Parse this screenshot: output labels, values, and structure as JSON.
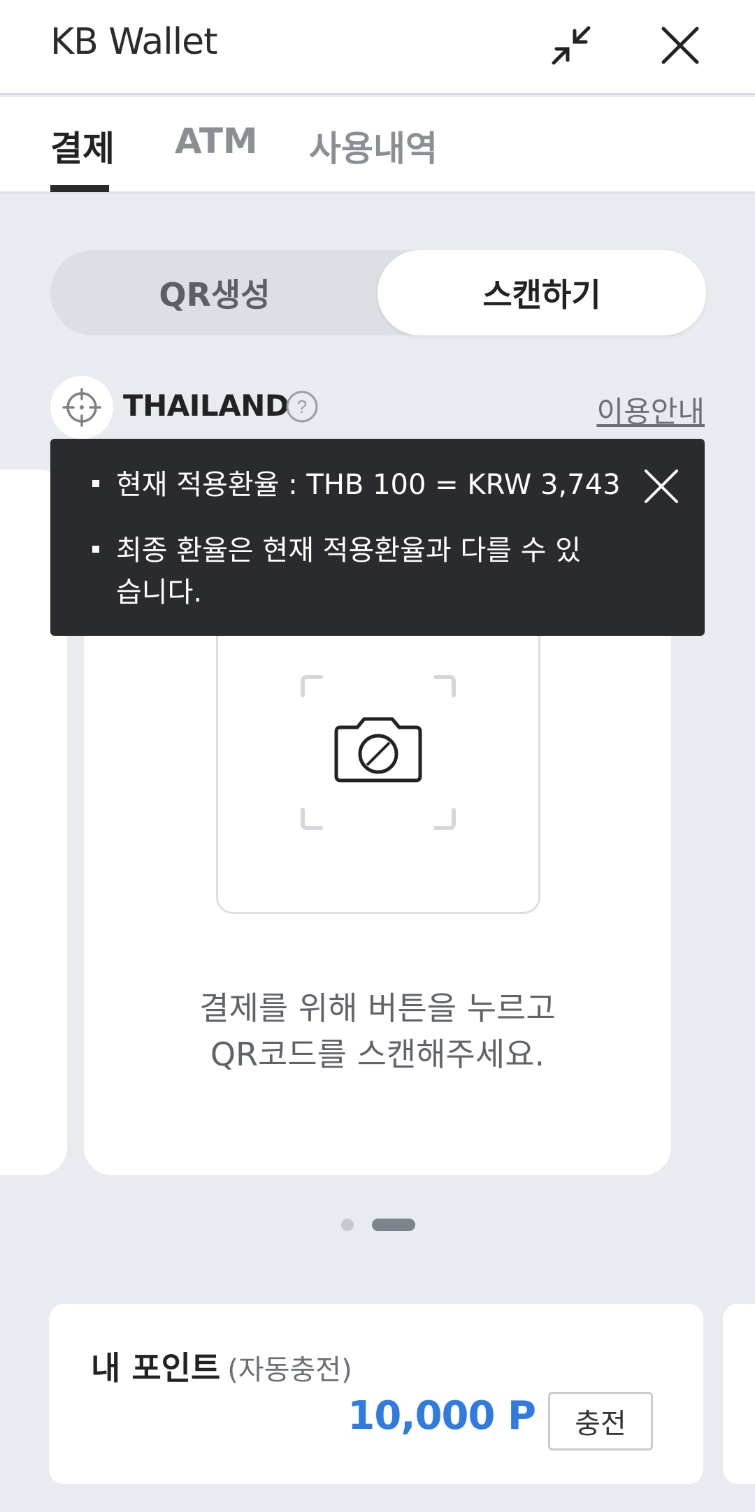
{
  "header": {
    "title": "KB Wallet",
    "minimize_icon": "minimize-arrows-icon",
    "close_icon": "close-icon"
  },
  "tabs": [
    {
      "label": "결제",
      "active": true
    },
    {
      "label": "ATM",
      "active": false
    },
    {
      "label": "사용내역",
      "active": false
    }
  ],
  "segment": {
    "qr_label": "QR생성",
    "scan_label": "스캔하기",
    "selected": "스캔하기"
  },
  "country": {
    "name": "THAILAND",
    "guide_label": "이용안내"
  },
  "tooltip": {
    "line1": "현재 적용환율 : THB 100 = KRW 3,743",
    "line2": "최종 환율은 현재 적용환율과 다를 수 있습니다."
  },
  "scan": {
    "caption_line1": "결제를 위해 버튼을 누르고",
    "caption_line2": "QR코드를 스캔해주세요."
  },
  "pager": {
    "total": 2,
    "current": 2
  },
  "points": {
    "title": "내 포인트",
    "subtitle": "(자동충전)",
    "value": "10,000 P",
    "charge_label": "충전"
  },
  "colors": {
    "accent_blue": "#2f7be0",
    "tooltip_bg": "#2a2b2f",
    "page_bg": "#e8ebef"
  }
}
